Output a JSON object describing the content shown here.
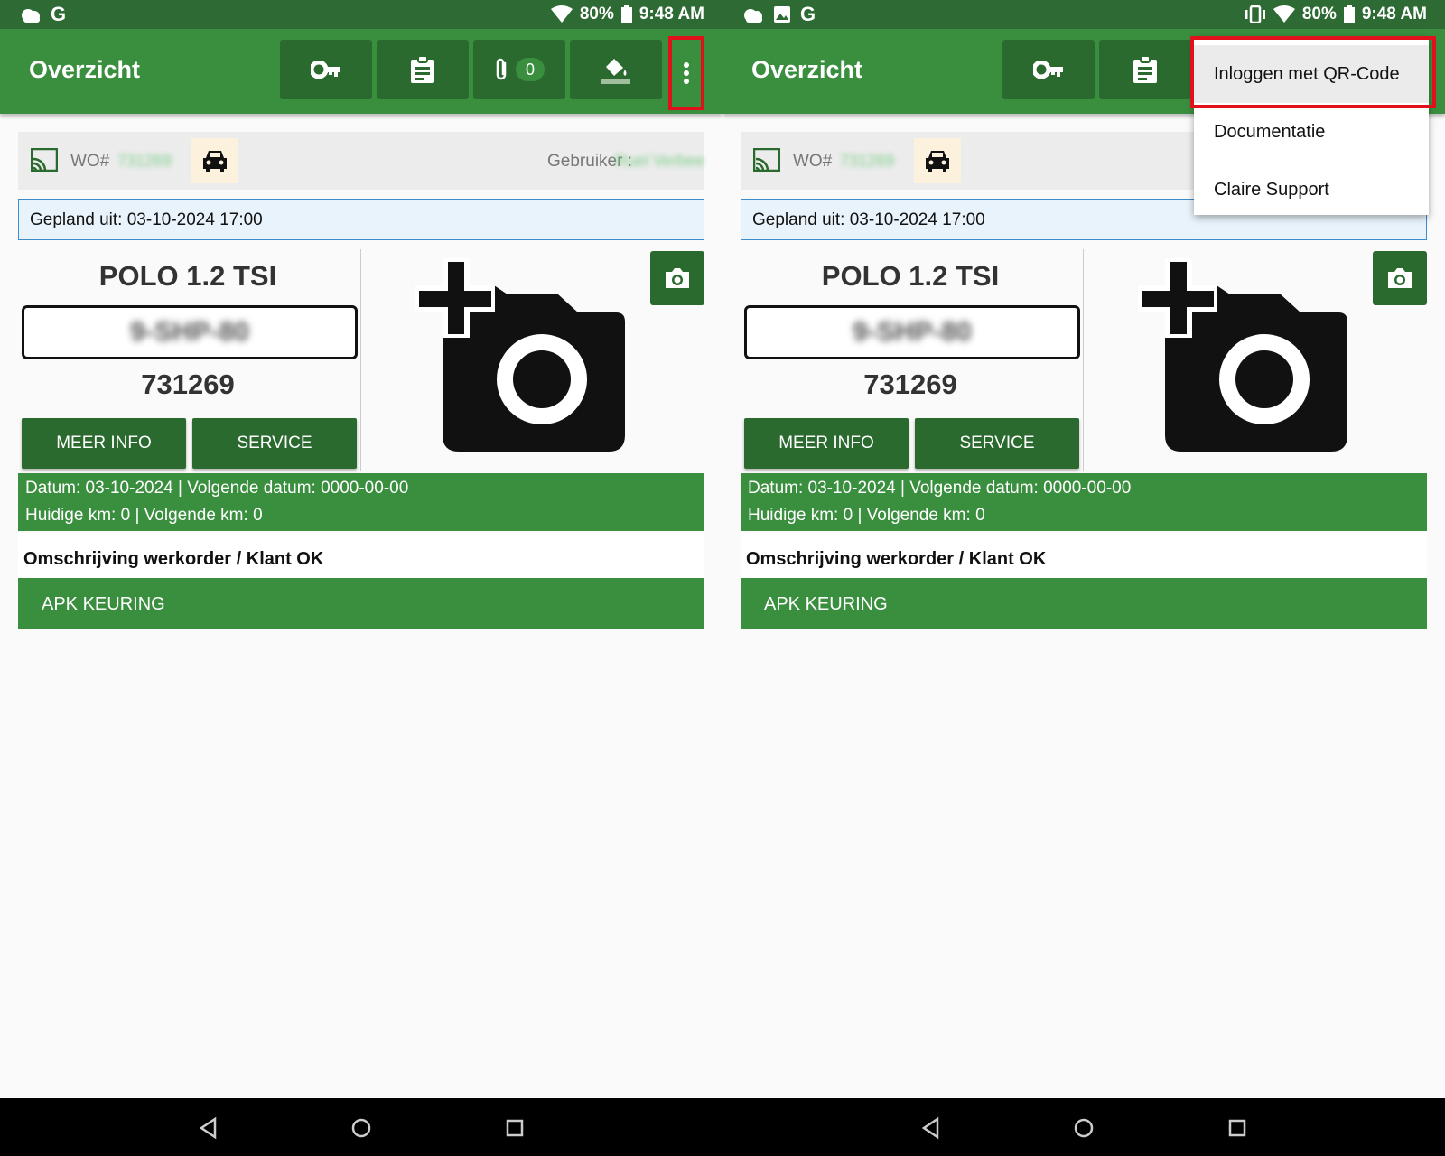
{
  "status_left": {
    "time": "9:48 AM",
    "battery": "80%"
  },
  "status_right": {
    "time": "9:48 AM",
    "battery": "80%"
  },
  "status_g": "G",
  "app": {
    "title": "Overzicht",
    "attachment_count": "0"
  },
  "wo": {
    "label": "WO#",
    "number_hidden": "731269",
    "user_label": "Gebruiker :",
    "user_hidden": "Ruel Verbee"
  },
  "planned": "Gepland uit:  03-10-2024 17:00",
  "vehicle": {
    "model": "POLO 1.2 TSI",
    "plate_hidden": "9-SHP-80",
    "number": "731269",
    "more_info": "MEER INFO",
    "service": "SERVICE"
  },
  "dates": {
    "line1": "Datum: 03-10-2024 | Volgende datum: 0000-00-00",
    "line2": "Huidige km: 0 | Volgende km: 0"
  },
  "description_header": "Omschrijving werkorder / Klant OK",
  "job": "APK KEURING",
  "menu": {
    "items": [
      "Inloggen met QR-Code",
      "Documentatie",
      "Claire Support"
    ]
  },
  "colors": {
    "primary": "#3a8f3f",
    "dark": "#2b6a2f",
    "statusbar": "#2e6b34",
    "highlight": "#e0111a"
  }
}
